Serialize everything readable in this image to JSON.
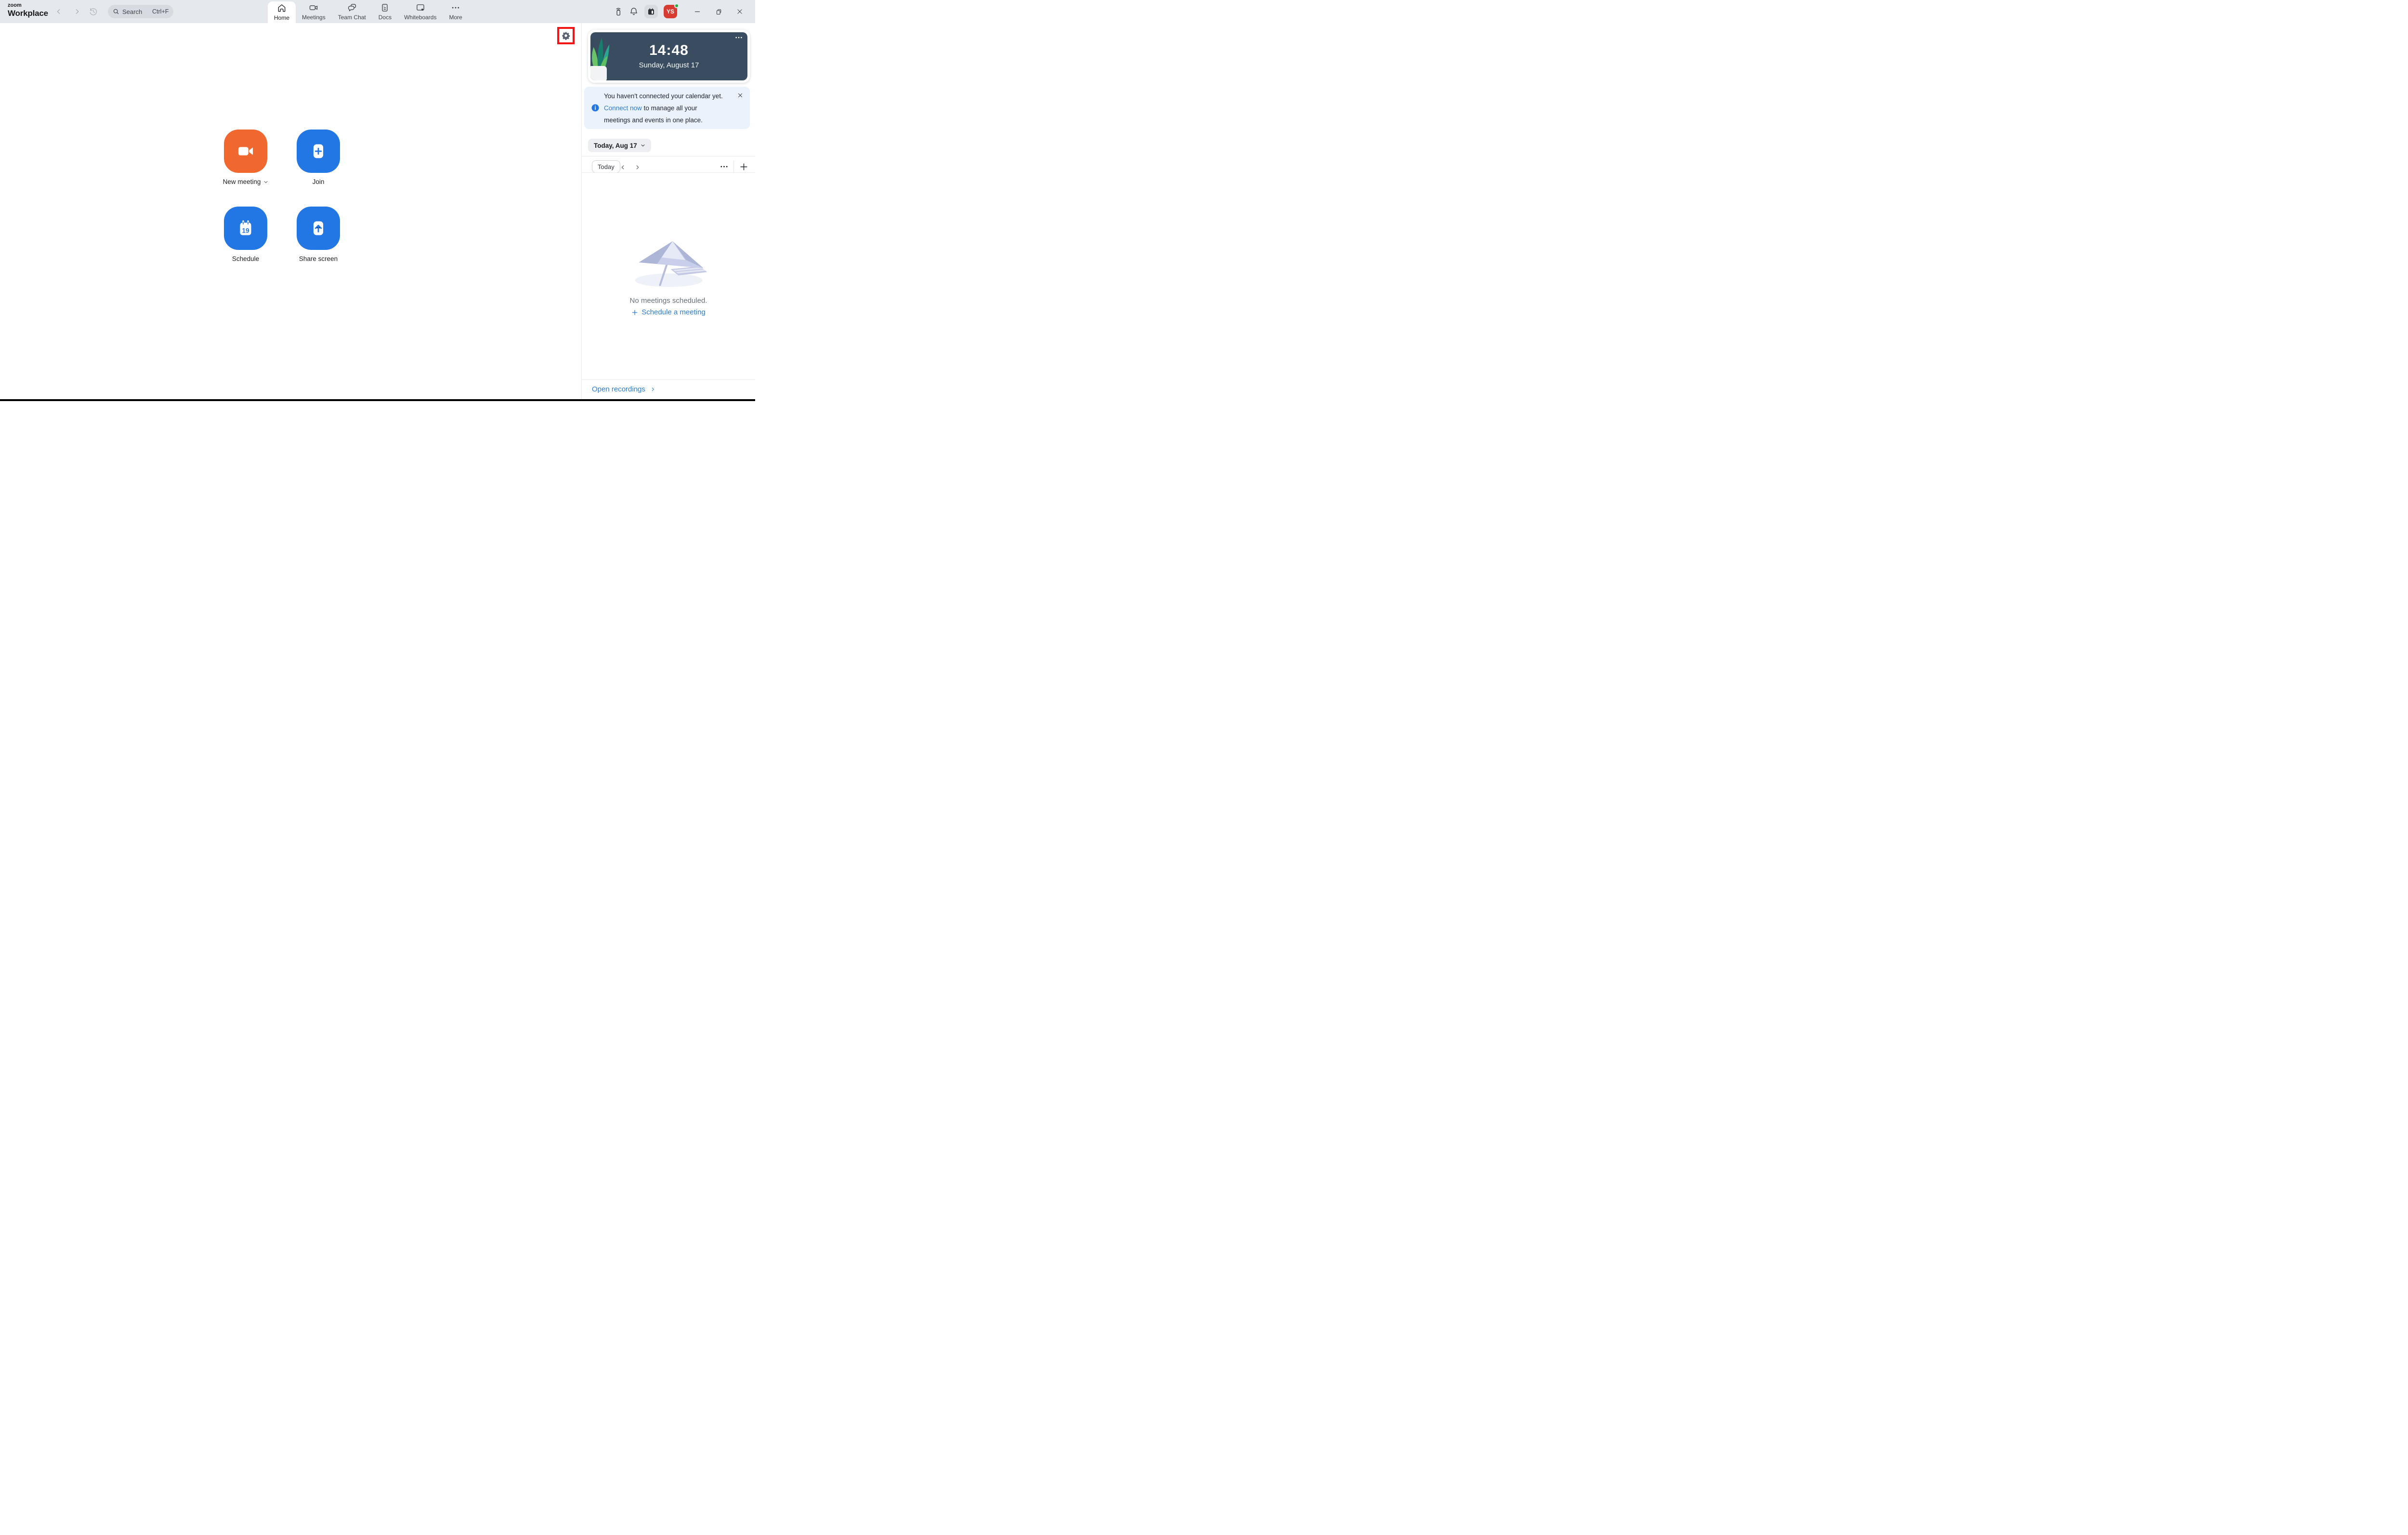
{
  "topbar": {
    "logo_line1": "zoom",
    "logo_line2": "Workplace",
    "search_placeholder": "Search",
    "search_shortcut": "Ctrl+F",
    "tabs": [
      {
        "label": "Home",
        "active": true
      },
      {
        "label": "Meetings",
        "active": false
      },
      {
        "label": "Team Chat",
        "active": false
      },
      {
        "label": "Docs",
        "active": false
      },
      {
        "label": "Whiteboards",
        "active": false
      },
      {
        "label": "More",
        "active": false
      }
    ],
    "avatar_initials": "YS"
  },
  "main": {
    "actions": [
      {
        "label": "New meeting",
        "icon": "video-camera-icon",
        "color": "#F0682F",
        "has_dropdown": true
      },
      {
        "label": "Join",
        "icon": "plus-icon",
        "color": "#2277E4"
      },
      {
        "label": "Schedule",
        "icon": "calendar-icon",
        "color": "#2277E4",
        "badge_day": "19"
      },
      {
        "label": "Share screen",
        "icon": "arrow-up-icon",
        "color": "#2277E4"
      }
    ]
  },
  "sidebar": {
    "clock": {
      "time": "14:48",
      "date": "Sunday, August 17"
    },
    "banner": {
      "text1": "You haven't connected your calendar yet.",
      "link_label": "Connect now",
      "text2": "to manage all your meetings and events in one place."
    },
    "date_selector_label": "Today, Aug 17",
    "toolbar": {
      "today_label": "Today"
    },
    "empty_state": {
      "message": "No meetings scheduled.",
      "cta_label": "Schedule a meeting"
    },
    "footer": {
      "recordings_label": "Open recordings"
    }
  },
  "colors": {
    "topbar_bg": "#E5E8EC",
    "accent_orange": "#F0682F",
    "accent_blue": "#2277E4",
    "link_blue": "#2B7BD9",
    "clock_card_bg": "#3A4D60",
    "banner_bg": "#EAF2FC",
    "avatar_bg": "#D83B31",
    "presence_green": "#27AE3C",
    "highlight_red": "#F01414"
  }
}
